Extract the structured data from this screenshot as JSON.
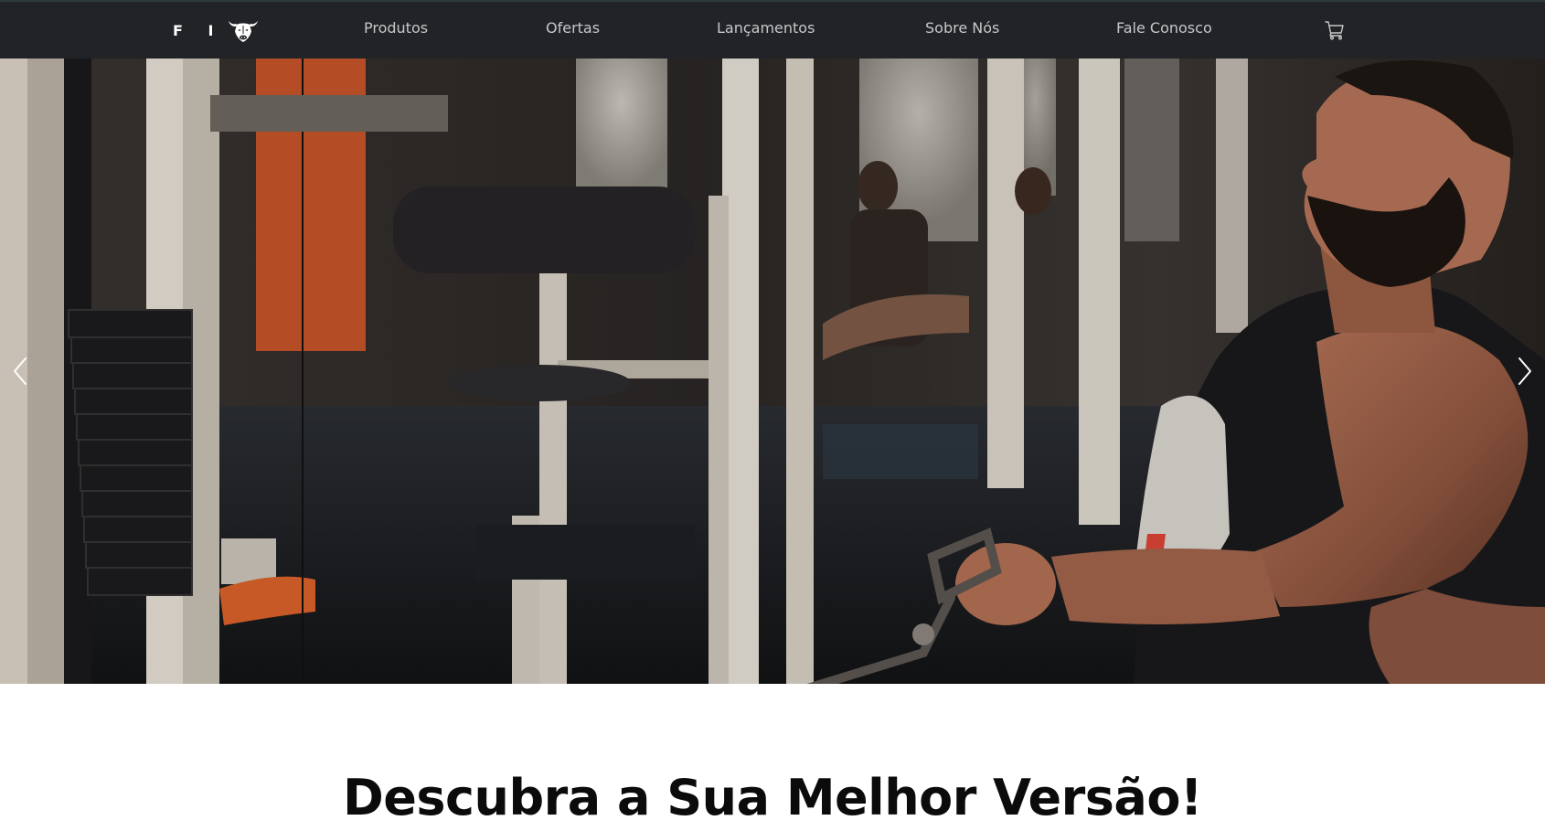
{
  "brand": {
    "text": "F I",
    "logo_icon": "muscle-bull-icon"
  },
  "nav": {
    "items": [
      {
        "label": "Produtos"
      },
      {
        "label": "Ofertas"
      },
      {
        "label": "Lançamentos"
      },
      {
        "label": "Sobre Nós"
      },
      {
        "label": "Fale Conosco"
      }
    ],
    "cart_icon": "cart-icon"
  },
  "hero": {
    "image_icon": "gym-photo",
    "prev_icon": "chevron-left-icon",
    "next_icon": "chevron-right-icon"
  },
  "headline": "Descubra a Sua Melhor Versão!",
  "colors": {
    "navbar_bg": "#212327",
    "nav_text": "#c5c7c9",
    "headline_text": "#0b0b0b",
    "page_bg": "#ffffff"
  }
}
